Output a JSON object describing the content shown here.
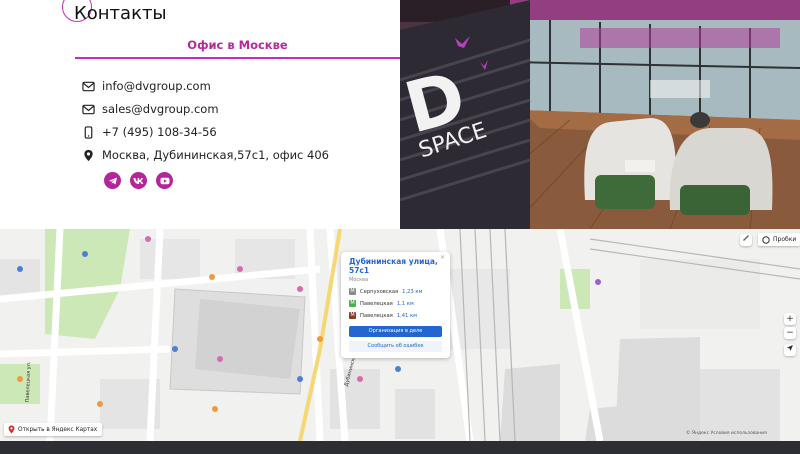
{
  "contacts": {
    "title": "Контакты",
    "office_heading": "Офис в Москве",
    "items": [
      {
        "icon": "mail-icon",
        "text": "info@dvgroup.com"
      },
      {
        "icon": "mail-icon",
        "text": "sales@dvgroup.com"
      },
      {
        "icon": "phone-icon",
        "text": "+7 (495) 108-34-56"
      },
      {
        "icon": "location-pin-icon",
        "text": "Москва, Дубининская,57с1, офис 406"
      }
    ],
    "socials": [
      "telegram-icon",
      "vk-icon",
      "youtube-icon"
    ],
    "accent_color": "#b7279f"
  },
  "photo": {
    "sign_text": "SPACE",
    "sign_big": "D"
  },
  "map": {
    "popup": {
      "title": "Дубининская улица, 57с1",
      "city": "Москва",
      "metro": [
        {
          "badge": "М",
          "color": "#8a8a8a",
          "name": "Серпуховская",
          "dist": "1,23 км"
        },
        {
          "badge": "М",
          "color": "#4caf50",
          "name": "Павелецкая",
          "dist": "1,1 км"
        },
        {
          "badge": "М",
          "color": "#8b3b2b",
          "name": "Павелецкая",
          "dist": "1,41 км"
        }
      ],
      "primary_button": "Организация в деле",
      "secondary_button": "Сообщить об ошибке",
      "close": "×"
    },
    "open_in_yandex": "Открыть в Яндекс Картах",
    "traffic": "Пробки",
    "zoom_in": "+",
    "zoom_out": "−",
    "copyright": "© Яндекс   Условия использования",
    "street_label": "Дубининская ул.",
    "street_label_2": "Павелецкая ул.",
    "brand_color": "#2366d1"
  }
}
